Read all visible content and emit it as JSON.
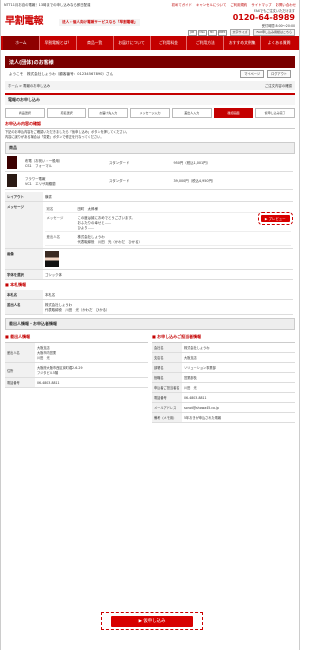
{
  "topbar": {
    "notice": "NTT11月お自の電報！13時までの申し込みなら即日配達",
    "links": [
      "初めてガイド",
      "キャンセルについて",
      "ご利用規約",
      "サイトマップ",
      "お問い合わせ"
    ]
  },
  "header": {
    "logo": "早割電報",
    "tagline": "法人・個人向け電報サービスなら「早割電報」",
    "fax_label": "FAXでもご注文いただけます",
    "phone": "0120-64-8989",
    "hours": "受付時間 8:00〜20:00",
    "cards": [
      "JCB",
      "VISA",
      "MC",
      "AMEX"
    ],
    "font_label": "文字サイズ",
    "fax_btn": "FAX申し込み用紙はこちら"
  },
  "nav": {
    "items": [
      "ホーム",
      "早割電報とは？",
      "商品一覧",
      "お届けについて",
      "ご利用料金",
      "ご利用方法",
      "おすすめ文例集",
      "よくある質問"
    ]
  },
  "welcome": {
    "title": "法人(団体)のお客様",
    "greeting": "ようこそ　株式会社しょうわ（顧客番号：01234567890）さん",
    "mypage": "マイページ",
    "logout": "ログアウト"
  },
  "breadcrumb": {
    "path": "ホーム > 電報のお申し込み",
    "help": "ご注文内容の確認"
  },
  "order_section": {
    "title": "電報のお申し込み",
    "steps": [
      "商品選択",
      "宛名選択",
      "お届け先入力",
      "メッセージ入力",
      "差出人入力",
      "確認画面",
      "仮申し込み完了"
    ],
    "active_step": 5,
    "subheading": "お申込み内容の確認",
    "note": "下記のお申込内容をご確認いただきましたら「仮申し込み」ボタンを押してください。\n内容に誤りがある場合は「変更」ボタンで修正を行なってください。"
  },
  "products": {
    "header": "商品",
    "rows": [
      {
        "name": "布電（お祝い・一般用）\nCS1　フォーマル",
        "type": "スタンダード",
        "price": "950円（税込1,001円）"
      },
      {
        "name": "フラワー電報\nVC1　エリザ胡蝶蘭",
        "type": "スタンダード",
        "price": "39,000円（税込4,950円）"
      }
    ]
  },
  "details": {
    "layout_label": "レイアウト",
    "layout_value": "横書",
    "message_label": "メッセージ",
    "recipient_label": "宛名",
    "recipient_value": "田町　太郎様",
    "message_inner_label": "メッセージ",
    "message_text": "この度は誠におめでとうございます。\nおふたりの幸せと……\nひより……",
    "preview_btn": "プレビュー",
    "sender_label": "差出人名",
    "sender_value": "株式会社しょうわ\n代表取締役　川田　光（かわだ　ひかる）",
    "photo_label": "画像",
    "font_label": "字体を選択",
    "font_value": "ゴシック体"
  },
  "honfuda": {
    "title": "本札情報",
    "name_label": "本札名",
    "name_value": "本札名",
    "sender_label": "差出人名",
    "sender_value": "株式会社しょうわ\n代表取締役　川田　光（かわだ　ひかる）"
  },
  "contacts": {
    "header": "差出人情報・お申込者情報",
    "left_title": "差出人情報",
    "left": [
      {
        "label": "差出人名",
        "value": "大阪支店\n大阪市内営業\n川田　光"
      },
      {
        "label": "住所",
        "value": "大阪府大阪市西区京町堀2-6-29\nフジタビル5階"
      },
      {
        "label": "電話番号",
        "value": "06-4803-8811"
      }
    ],
    "right_title": "お申し込みご担当者情報",
    "right": [
      {
        "label": "会社名",
        "value": "株式会社しょうわ"
      },
      {
        "label": "支店名",
        "value": "大阪支店"
      },
      {
        "label": "部署名",
        "value": "ソリューション事業部"
      },
      {
        "label": "役職名",
        "value": "営業部長"
      },
      {
        "label": "申込者ご担当者名",
        "value": "川田　光"
      },
      {
        "label": "電話番号",
        "value": "06-4803-8811"
      },
      {
        "label": "メールアドレス",
        "value": "sonot@showa45.co.jp"
      },
      {
        "label": "備考（メモ用）",
        "value": "5年おきが申込された電報"
      }
    ]
  },
  "footer": {
    "submit": "仮申し込み"
  },
  "colors": {
    "brand": "#c40000",
    "dark": "#7a0000"
  }
}
